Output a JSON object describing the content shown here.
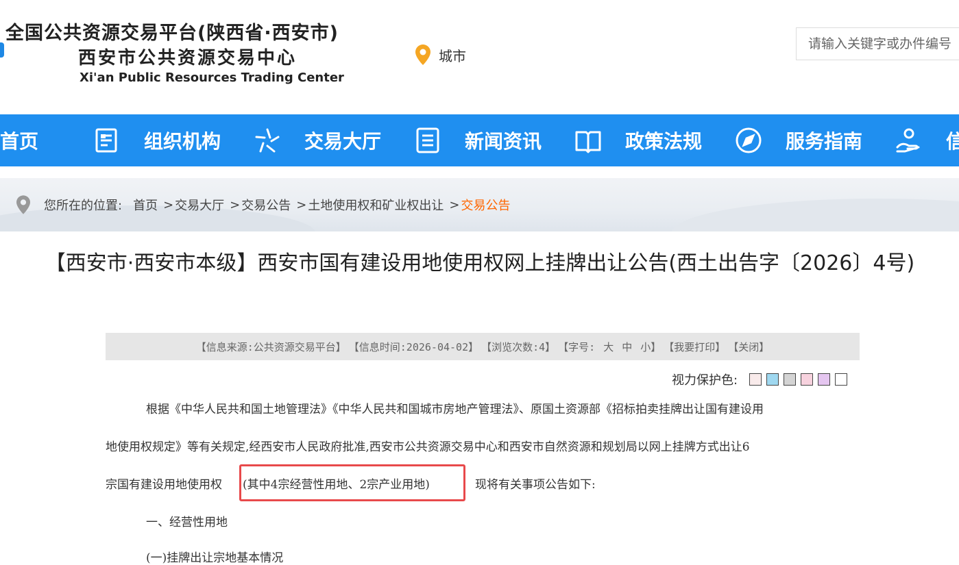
{
  "header": {
    "title_line1": "全国公共资源交易平台(陕西省·西安市)",
    "title_line2": "西安市公共资源交易中心",
    "title_en": "Xi'an Public Resources Trading Center",
    "city_label": "城市",
    "search_placeholder": "请输入关键字或办件编号"
  },
  "nav": {
    "items": [
      {
        "label": "首页",
        "icon": "home-icon"
      },
      {
        "label": "组织机构",
        "icon": "document-icon"
      },
      {
        "label": "交易大厅",
        "icon": "star-icon"
      },
      {
        "label": "新闻资讯",
        "icon": "list-icon"
      },
      {
        "label": "政策法规",
        "icon": "book-icon"
      },
      {
        "label": "服务指南",
        "icon": "compass-icon"
      },
      {
        "label": "信",
        "icon": "hand-service-icon"
      }
    ]
  },
  "breadcrumb": {
    "prefix": "您所在的位置:",
    "items": [
      "首页",
      "交易大厅",
      "交易公告",
      "土地使用权和矿业权出让",
      "交易公告"
    ]
  },
  "article": {
    "title": "【西安市·西安市本级】西安市国有建设用地使用权网上挂牌出让公告(西土出告字〔2026〕4号)",
    "meta": {
      "source": "【信息来源:公共资源交易平台】",
      "time": "【信息时间:2026-04-02】",
      "views": "【浏览次数:4】",
      "font_label": "【字号:",
      "font_large": "大",
      "font_medium": "中",
      "font_small": "小】",
      "print": "【我要打印】",
      "close": "【关闭】"
    },
    "vision_label": "视力保护色:",
    "vision_colors": [
      "#f9ebeb",
      "#9fd8f0",
      "#d4d4d4",
      "#f7d2de",
      "#e5c6f0",
      "#ffffff"
    ],
    "paragraph_lines": [
      "根据《中华人民共和国土地管理法》《中华人民共和国城市房地产管理法》、原国土资源部《招标拍卖挂牌出让国有建设用",
      "地使用权规定》等有关规定,经西安市人民政府批准,西安市公共资源交易中心和西安市自然资源和规划局以网上挂牌方式出让6",
      "宗国有建设用地使用权",
      "(其中4宗经营性用地、2宗产业用地)",
      "现将有关事项公告如下:"
    ],
    "section1": "一、经营性用地",
    "section1_sub": "(一)挂牌出让宗地基本情况"
  }
}
